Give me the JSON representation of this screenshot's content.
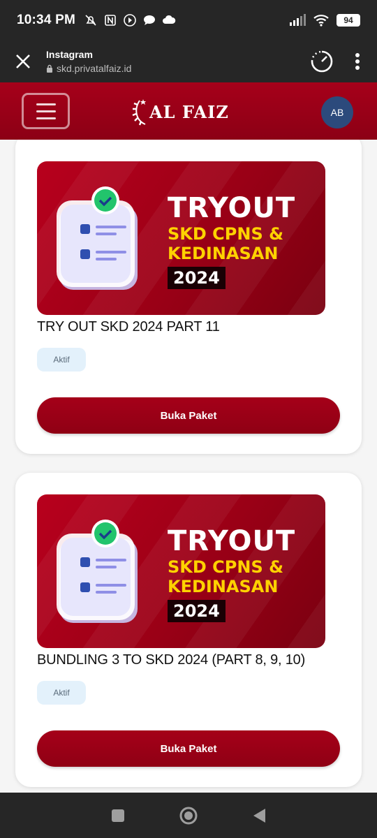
{
  "status_bar": {
    "time": "10:34 PM",
    "battery": "94"
  },
  "browser": {
    "title": "Instagram",
    "url": "skd.privatalfaiz.id"
  },
  "header": {
    "logo_text": "AL FAIZ",
    "avatar_initials": "AB"
  },
  "cards": [
    {
      "banner": {
        "title": "TRYOUT",
        "line1": "SKD CPNS &",
        "line2": "KEDINASAN",
        "year": "2024"
      },
      "title": "TRY OUT SKD 2024 PART 11",
      "status": "Aktif",
      "button_label": "Buka Paket"
    },
    {
      "banner": {
        "title": "TRYOUT",
        "line1": "SKD CPNS &",
        "line2": "KEDINASAN",
        "year": "2024"
      },
      "title": "BUNDLING 3 TO SKD 2024 (PART 8, 9, 10)",
      "status": "Aktif",
      "button_label": "Buka Paket"
    }
  ],
  "colors": {
    "brand": "#9a0016",
    "accent_yellow": "#ffd200",
    "badge_bg": "#e3f1fb"
  }
}
